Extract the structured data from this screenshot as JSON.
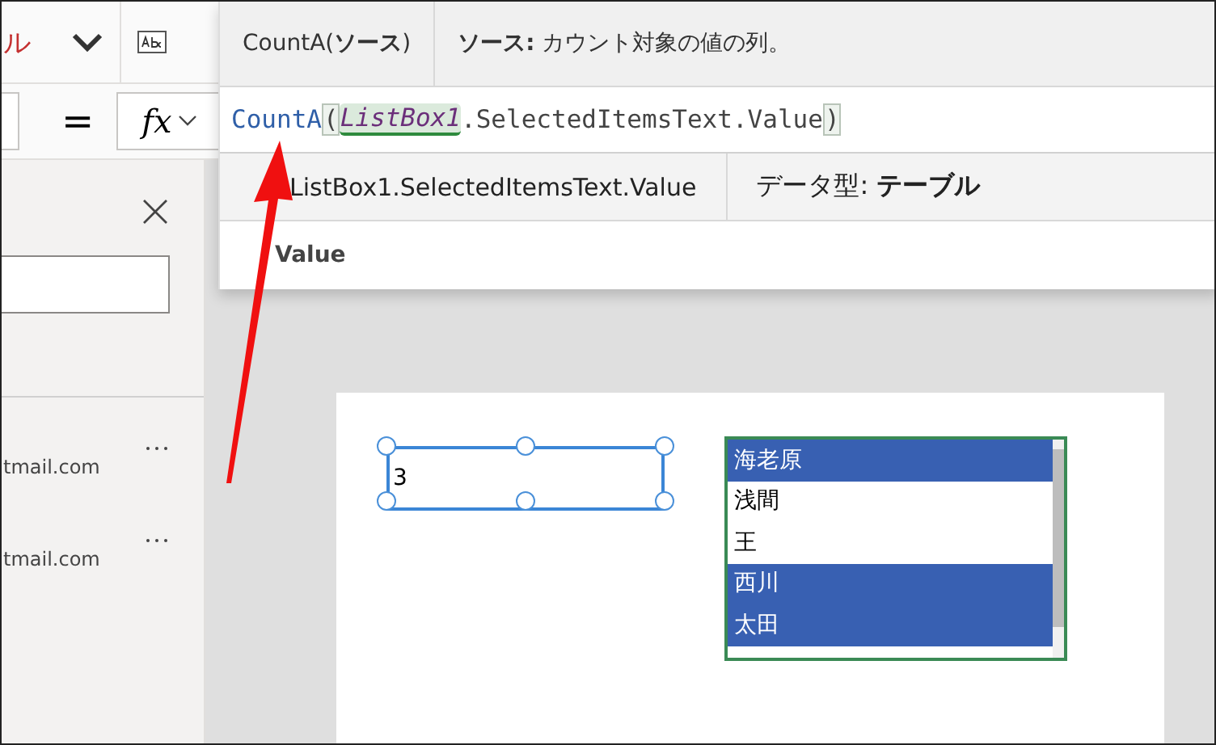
{
  "toolbar": {
    "label": "ル"
  },
  "formula_bar": {
    "operator": "=",
    "fx_label": "fx"
  },
  "panel": {
    "items": [
      {
        "text": "tmail.com"
      },
      {
        "text": "tmail.com"
      }
    ]
  },
  "intellisense": {
    "signature": "CountA(**ソース**)",
    "description": "**ソース:** カウント対象の値の列。",
    "formula": [
      {
        "kind": "function",
        "text": "CountA"
      },
      {
        "kind": "paren",
        "text": "("
      },
      {
        "kind": "reference",
        "text": "ListBox1"
      },
      {
        "kind": "text",
        "text": ".SelectedItemsText.Value"
      },
      {
        "kind": "paren",
        "text": ")"
      }
    ],
    "result_path": "ListBox1.SelectedItemsText.Value",
    "data_type": "データ型: **テーブル**",
    "column": "Value"
  },
  "canvas": {
    "label": {
      "text": "3",
      "selected": true
    },
    "listbox": {
      "items": [
        {
          "text": "海老原",
          "selected": true
        },
        {
          "text": "浅間",
          "selected": false
        },
        {
          "text": "王",
          "selected": false
        },
        {
          "text": "西川",
          "selected": true
        },
        {
          "text": "太田",
          "selected": true
        }
      ]
    }
  }
}
